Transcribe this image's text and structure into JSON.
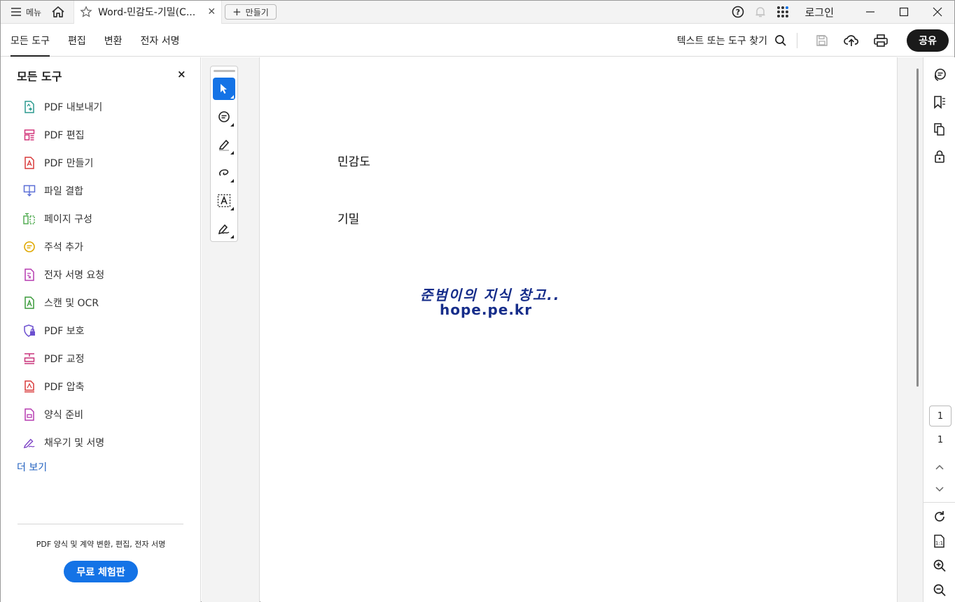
{
  "titlebar": {
    "menu_label": "메뉴",
    "tab_title": "Word-민감도-기밀(C...",
    "create_label": "만들기",
    "login_label": "로그인",
    "icons": [
      "hamburger-icon",
      "home-icon",
      "star-icon",
      "close-icon",
      "plus-icon",
      "help-icon",
      "bell-icon",
      "apps-icon",
      "minimize-icon",
      "maximize-icon",
      "close-icon"
    ]
  },
  "toolbar": {
    "tabs": [
      {
        "label": "모든 도구",
        "active": true
      },
      {
        "label": "편집",
        "active": false
      },
      {
        "label": "변환",
        "active": false
      },
      {
        "label": "전자 서명",
        "active": false
      }
    ],
    "search_label": "텍스트 또는 도구 찾기",
    "share_label": "공유"
  },
  "left_panel": {
    "title": "모든 도구",
    "close_label": "×",
    "tools": [
      {
        "label": "PDF 내보내기",
        "icon": "export-pdf-icon",
        "color": "#2b9a8f"
      },
      {
        "label": "PDF 편집",
        "icon": "edit-pdf-icon",
        "color": "#d2357a"
      },
      {
        "label": "PDF 만들기",
        "icon": "create-pdf-icon",
        "color": "#d93a3a"
      },
      {
        "label": "파일 결합",
        "icon": "combine-files-icon",
        "color": "#5b6fd6"
      },
      {
        "label": "페이지 구성",
        "icon": "organize-pages-icon",
        "color": "#4aa84a"
      },
      {
        "label": "주석 추가",
        "icon": "comment-icon",
        "color": "#e0a800"
      },
      {
        "label": "전자 서명 요청",
        "icon": "request-esign-icon",
        "color": "#b63bb0"
      },
      {
        "label": "스캔 및 OCR",
        "icon": "scan-ocr-icon",
        "color": "#3a9a3a"
      },
      {
        "label": "PDF 보호",
        "icon": "protect-pdf-icon",
        "color": "#6b4fcf"
      },
      {
        "label": "PDF 교정",
        "icon": "redact-pdf-icon",
        "color": "#c8327a"
      },
      {
        "label": "PDF 압축",
        "icon": "compress-pdf-icon",
        "color": "#d93a3a"
      },
      {
        "label": "양식 준비",
        "icon": "prepare-form-icon",
        "color": "#b63bb0"
      },
      {
        "label": "채우기 및 서명",
        "icon": "fill-sign-icon",
        "color": "#7a3fc4"
      }
    ],
    "more_label": "더 보기",
    "promo_text": "PDF 양식 및 계약 변환, 편집, 전자 서명",
    "trial_label": "무료 체험판"
  },
  "quick_tools": [
    "select-cursor-icon",
    "add-comment-icon",
    "highlight-icon",
    "draw-freeform-icon",
    "text-select-icon",
    "sign-icon"
  ],
  "document": {
    "line1": "민감도",
    "line2": "기밀",
    "watermark1": "준범이의 지식 창고..",
    "watermark2": "hope.pe.kr"
  },
  "right_rail": {
    "current_page": "1",
    "total_pages": "1"
  },
  "colors": {
    "accent_blue": "#1473e6",
    "share_bg": "#1a1a1a",
    "watermark": "#162d8a",
    "link": "#1f5fbf"
  }
}
